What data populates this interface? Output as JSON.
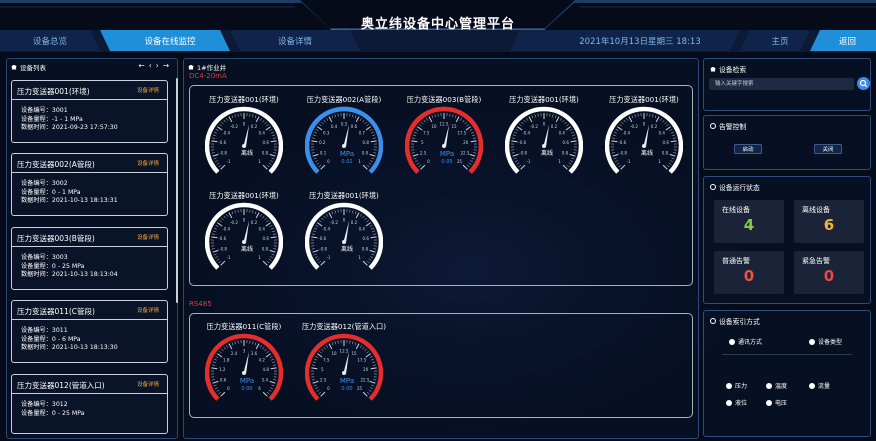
{
  "app": {
    "title": "奥立纬设备中心管理平台"
  },
  "nav": {
    "tab_overview": "设备总览",
    "tab_monitor": "设备在线监控",
    "tab_detail": "设备详情",
    "datetime": "2021年10月13日星期三 18:13",
    "home": "主页",
    "back": "返回"
  },
  "left": {
    "title": "设备列表",
    "pager": [
      "←",
      "‹",
      "›",
      "→"
    ],
    "devices": [
      {
        "name": "压力变送器001(环境)",
        "link": "设备详情",
        "code": "设备编号：3001",
        "range": "设备量程：-1 - 1 MPa",
        "time": "数据时间：2021-09-23 17:57:30"
      },
      {
        "name": "压力变送器002(A管段)",
        "link": "设备详情",
        "code": "设备编号：3002",
        "range": "设备量程：0 - 1 MPa",
        "time": "数据时间：2021-10-13 18:13:31"
      },
      {
        "name": "压力变送器003(B管段)",
        "link": "设备详情",
        "code": "设备编号：3003",
        "range": "设备量程：0 - 25 MPa",
        "time": "数据时间：2021-10-13 18:13:04"
      },
      {
        "name": "压力变送器011(C管段)",
        "link": "设备详情",
        "code": "设备编号：3011",
        "range": "设备量程：0 - 6 MPa",
        "time": "数据时间：2021-10-13 18:13:30"
      },
      {
        "name": "压力变送器012(管道入口)",
        "link": "设备详情",
        "code": "设备编号：3012",
        "range": "设备量程：0 - 25 MPa",
        "time": ""
      }
    ]
  },
  "center": {
    "title": "1#作业井",
    "section1": "DC4-20mA",
    "section2": "RS485",
    "gauges": [
      {
        "name": "压力变送器001(环境)",
        "color": "#ffffff",
        "fill": 0,
        "value": "",
        "unit": "",
        "status": "离线",
        "ticks": [
          "-1",
          "-0.8",
          "-0.6",
          "-0.4",
          "-0.2",
          "0",
          "0.2",
          "0.4",
          "0.6",
          "0.8",
          "1"
        ]
      },
      {
        "name": "压力变送器002(A管段)",
        "color": "#3b8fe8",
        "fill": 0.6,
        "value": "0.02",
        "unit": "MPa",
        "status": "",
        "ticks": [
          "0",
          "0.1",
          "0.2",
          "0.3",
          "0.4",
          "0.5",
          "0.6",
          "0.7",
          "0.8",
          "0.9",
          "1"
        ]
      },
      {
        "name": "压力变送器003(B管段)",
        "color": "#e52d2d",
        "fill": 1,
        "value": "0.05",
        "unit": "MPa",
        "status": "",
        "ticks": [
          "0",
          "2.5",
          "5",
          "7.5",
          "10",
          "12.5",
          "15",
          "17.5",
          "20",
          "22.5",
          "25"
        ]
      },
      {
        "name": "压力变送器001(环境)",
        "color": "#ffffff",
        "fill": 0,
        "value": "",
        "unit": "",
        "status": "离线",
        "ticks": [
          "-1",
          "-0.8",
          "-0.6",
          "-0.4",
          "-0.2",
          "0",
          "0.2",
          "0.4",
          "0.6",
          "0.8",
          "1"
        ]
      },
      {
        "name": "压力变送器001(环境)",
        "color": "#ffffff",
        "fill": 0,
        "value": "",
        "unit": "",
        "status": "离线",
        "ticks": [
          "-1",
          "-0.8",
          "-0.6",
          "-0.4",
          "-0.2",
          "0",
          "0.2",
          "0.4",
          "0.6",
          "0.8",
          "1"
        ]
      },
      {
        "name": "压力变送器001(环境)",
        "color": "#ffffff",
        "fill": 0,
        "value": "",
        "unit": "",
        "status": "离线",
        "ticks": [
          "-1",
          "-0.8",
          "-0.6",
          "-0.4",
          "-0.2",
          "0",
          "0.2",
          "0.4",
          "0.6",
          "0.8",
          "1"
        ]
      },
      {
        "name": "压力变送器001(环境)",
        "color": "#ffffff",
        "fill": 0,
        "value": "",
        "unit": "",
        "status": "离线",
        "ticks": [
          "-1",
          "-0.8",
          "-0.6",
          "-0.4",
          "-0.2",
          "0",
          "0.2",
          "0.4",
          "0.6",
          "0.8",
          "1"
        ]
      },
      {
        "name": "压力变送器011(C管段)",
        "color": "#e52d2d",
        "fill": 0.15,
        "value": "0.00",
        "unit": "MPa",
        "status": "",
        "ticks": [
          "0",
          "0.6",
          "1.2",
          "1.8",
          "2.4",
          "3",
          "3.6",
          "4.2",
          "4.8",
          "5.4",
          "6"
        ]
      },
      {
        "name": "压力变送器012(管道入口)",
        "color": "#e52d2d",
        "fill": 0,
        "value": "0.00",
        "unit": "MPa",
        "status": "",
        "ticks": [
          "0",
          "2.5",
          "5",
          "7.5",
          "10",
          "12.5",
          "15",
          "17.5",
          "20",
          "22.5",
          "25"
        ]
      }
    ]
  },
  "right": {
    "search_title": "设备检索",
    "search_placeholder": "输入关键字搜索",
    "alarm_title": "告警控制",
    "alarm_on": "启动",
    "alarm_off": "关闭",
    "status_title": "设备运行状态",
    "stats": [
      {
        "label": "在线设备",
        "value": "4",
        "color": "#7fd13b"
      },
      {
        "label": "离线设备",
        "value": "6",
        "color": "#f0b43a"
      },
      {
        "label": "普通告警",
        "value": "0",
        "color": "#e8553d"
      },
      {
        "label": "紧急告警",
        "value": "0",
        "color": "#e84545"
      }
    ],
    "index_title": "设备索引方式",
    "index_modes": [
      "通讯方式",
      "设备类型"
    ],
    "types": [
      "压力",
      "温度",
      "流量",
      "液位",
      "电压"
    ]
  }
}
